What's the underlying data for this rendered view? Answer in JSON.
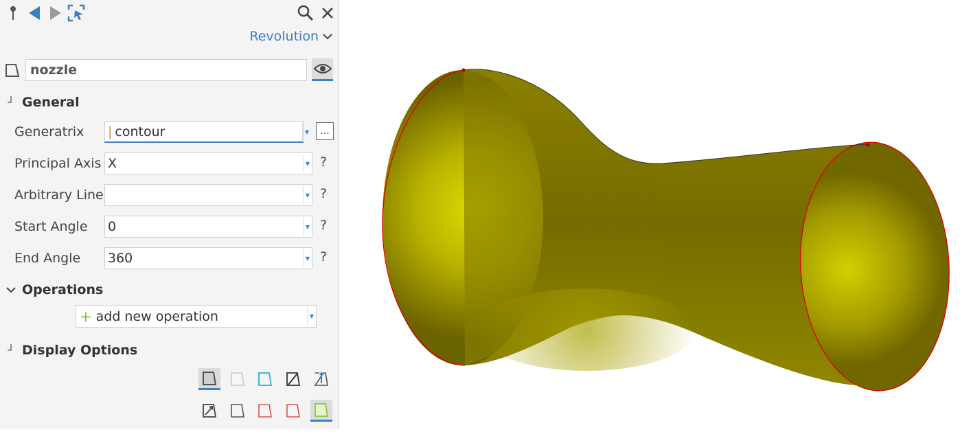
{
  "panel": {
    "title_dropdown": "Revolution",
    "object_name": "nozzle",
    "sections": {
      "general": "General",
      "operations": "Operations",
      "display": "Display Options"
    },
    "properties": [
      {
        "label": "Generatrix",
        "value": "contour"
      },
      {
        "label": "Principal Axis",
        "value": "X"
      },
      {
        "label": "Arbitrary Line",
        "value": ""
      },
      {
        "label": "Start Angle",
        "value": "0"
      },
      {
        "label": "End Angle",
        "value": "360"
      }
    ],
    "help_label": "?",
    "ellipsis_label": "...",
    "operation_dropdown": "add new operation"
  },
  "toolbar_icons": [
    "pin-icon",
    "back-arrow-icon",
    "forward-arrow-icon",
    "select-cursor-icon",
    "search-icon",
    "close-icon"
  ],
  "colors": {
    "accent": "#3b7fc4",
    "surface": "#b3b300",
    "edge": "#e00000",
    "plus": "#7bbf3a"
  }
}
